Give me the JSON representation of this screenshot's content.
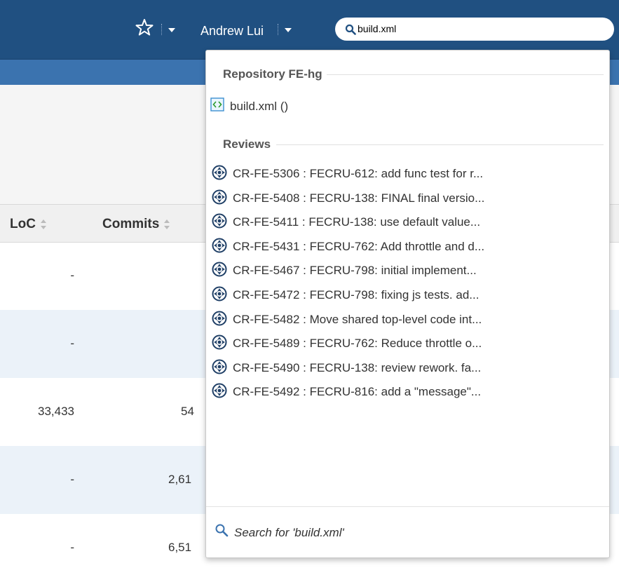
{
  "header": {
    "user_name": "Andrew Lui",
    "search": {
      "value": "build.xml",
      "placeholder": ""
    },
    "colors": {
      "bar": "#205081",
      "subbar": "#3b73af"
    }
  },
  "table": {
    "columns": {
      "loc": "LoC",
      "commits": "Commits"
    },
    "rows": [
      {
        "loc": "-",
        "commits": ""
      },
      {
        "loc": "-",
        "commits": ""
      },
      {
        "loc": "33,433",
        "commits": "54"
      },
      {
        "loc": "-",
        "commits": "2,61"
      },
      {
        "loc": "-",
        "commits": "6,51"
      }
    ]
  },
  "dropdown": {
    "repository_heading": "Repository FE-hg",
    "file_result": {
      "label": "build.xml ()",
      "icon": "xml-file-icon"
    },
    "reviews_heading": "Reviews",
    "reviews": [
      "CR-FE-5306 : FECRU-612: add func test for r...",
      "CR-FE-5408 : FECRU-138: FINAL final versio...",
      "CR-FE-5411 : FECRU-138: use default value...",
      "CR-FE-5431 : FECRU-762: Add throttle and d...",
      "CR-FE-5467 : FECRU-798: initial implement...",
      "CR-FE-5472 : FECRU-798: fixing js tests. ad...",
      "CR-FE-5482 : Move shared top-level code int...",
      "CR-FE-5489 : FECRU-762: Reduce throttle o...",
      "CR-FE-5490 : FECRU-138: review rework. fa...",
      "CR-FE-5492 : FECRU-816: add a \"message\"..."
    ],
    "search_for": "Search for 'build.xml'"
  }
}
